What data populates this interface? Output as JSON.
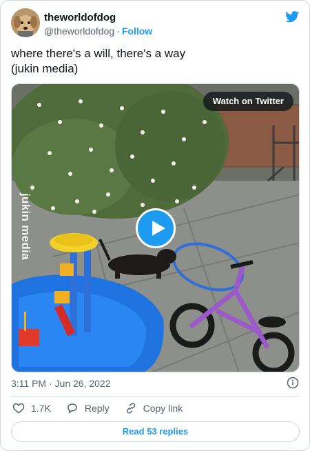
{
  "author": {
    "display_name": "theworldofdog",
    "handle": "@theworldofdog",
    "separator": "·",
    "follow_label": "Follow",
    "avatar_icon": "dog-avatar"
  },
  "brand_icon": "twitter-bird-icon",
  "tweet": {
    "text": "where there's a will, there's a way\n(jukin media)"
  },
  "media": {
    "type": "video",
    "watch_label": "Watch on Twitter",
    "watermark": "jukin media",
    "play_icon": "play-icon"
  },
  "meta": {
    "timestamp": "3:11 PM · Jun 26, 2022",
    "info_icon": "info-icon"
  },
  "actions": {
    "likes_count": "1.7K",
    "reply_label": "Reply",
    "copy_link_label": "Copy link"
  },
  "replies_button_label": "Read 53 replies",
  "colors": {
    "accent": "#1d9bf0",
    "text_primary": "#0f1419",
    "text_secondary": "#536471",
    "border": "#cfd9de"
  }
}
